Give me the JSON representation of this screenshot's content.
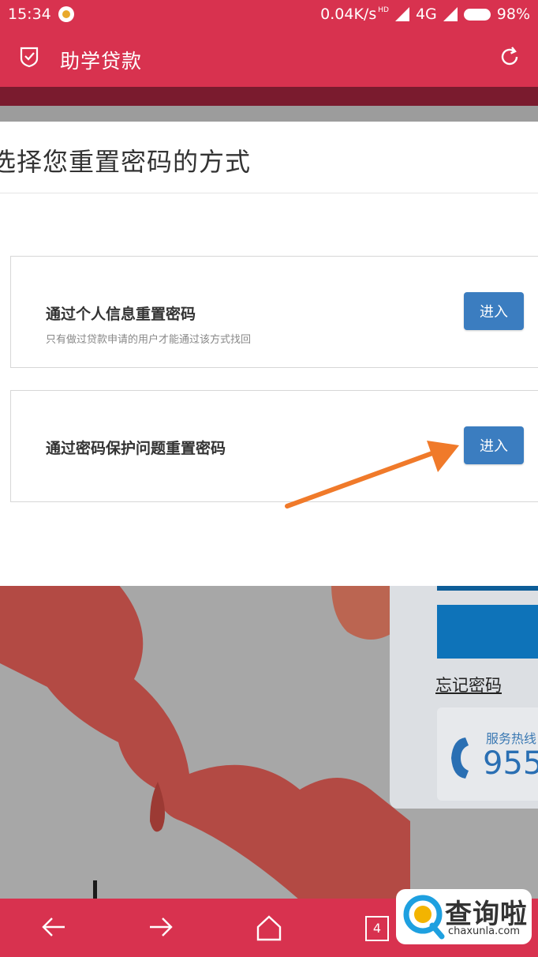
{
  "status_bar": {
    "time": "15:34",
    "network_speed": "0.04K/s",
    "hd_label": "HD",
    "network_type": "4G",
    "battery": "98%"
  },
  "app_bar": {
    "title": "助学贷款",
    "icons": [
      "shield-check-icon",
      "refresh-icon"
    ]
  },
  "dialog": {
    "title": "选择您重置密码的方式",
    "options": [
      {
        "title": "通过个人信息重置密码",
        "description": "只有做过贷款申请的用户才能通过该方式找回",
        "button": "进入"
      },
      {
        "title": "通过密码保护问题重置密码",
        "button": "进入"
      }
    ]
  },
  "background_panel": {
    "forgot_password": "忘记密码",
    "hotline_label": "服务热线",
    "hotline_number": "955"
  },
  "nav_bar": {
    "tab_count": "4",
    "icons": [
      "back-arrow-icon",
      "forward-arrow-icon",
      "home-icon",
      "tabs-icon"
    ]
  },
  "watermark": {
    "title": "查询啦",
    "url": "chaxunla.com"
  },
  "colors": {
    "brand_red": "#d8324f",
    "button_blue": "#3b7dc0",
    "annotation_arrow": "#f07a2a"
  }
}
